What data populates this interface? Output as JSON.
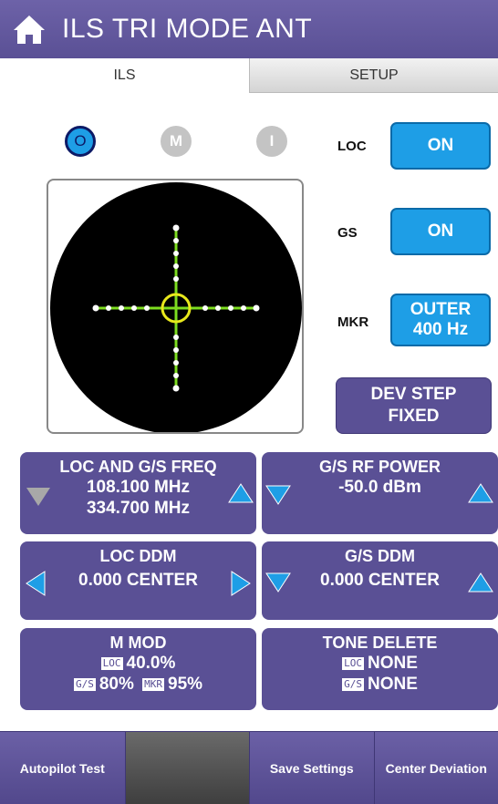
{
  "header": {
    "title": "ILS TRI MODE  ANT",
    "home_icon": "home-icon"
  },
  "tabs": [
    {
      "label": "ILS"
    },
    {
      "label": "SETUP"
    }
  ],
  "indicators": [
    {
      "label": "O",
      "state": "on"
    },
    {
      "label": "M",
      "state": "off"
    },
    {
      "label": "I",
      "state": "off"
    }
  ],
  "controls": {
    "loc": {
      "label": "LOC",
      "button": "ON"
    },
    "gs": {
      "label": "GS",
      "button": "ON"
    },
    "mkr": {
      "label": "MKR",
      "button_line1": "OUTER",
      "button_line2": "400 Hz"
    },
    "dev_step": {
      "line1": "DEV STEP",
      "line2": "FIXED"
    }
  },
  "panels": {
    "freq": {
      "title": "LOC AND G/S FREQ",
      "line1": "108.100 MHz",
      "line2": "334.700 MHz"
    },
    "rf_power": {
      "title": "G/S RF POWER",
      "value": "-50.0 dBm"
    },
    "loc_ddm": {
      "title": "LOC DDM",
      "value": "0.000 CENTER"
    },
    "gs_ddm": {
      "title": "G/S DDM",
      "value": "0.000 CENTER"
    },
    "m_mod": {
      "title": "M MOD",
      "loc_tag": "LOC",
      "loc_value": "40.0%",
      "gs_tag": "G/S",
      "gs_value": "80%",
      "mkr_tag": "MKR",
      "mkr_value": "95%"
    },
    "tone_delete": {
      "title": "TONE DELETE",
      "loc_tag": "LOC",
      "loc_value": "NONE",
      "gs_tag": "G/S",
      "gs_value": "NONE"
    }
  },
  "bottom": [
    {
      "label": "Autopilot Test"
    },
    {
      "label": ""
    },
    {
      "label": "Save Settings"
    },
    {
      "label": "Center Deviation"
    }
  ],
  "colors": {
    "purple": "#5a5095",
    "blue": "#1e9ee6",
    "scope_green": "#7ddc1f",
    "scope_yellow": "#e8e81c"
  }
}
